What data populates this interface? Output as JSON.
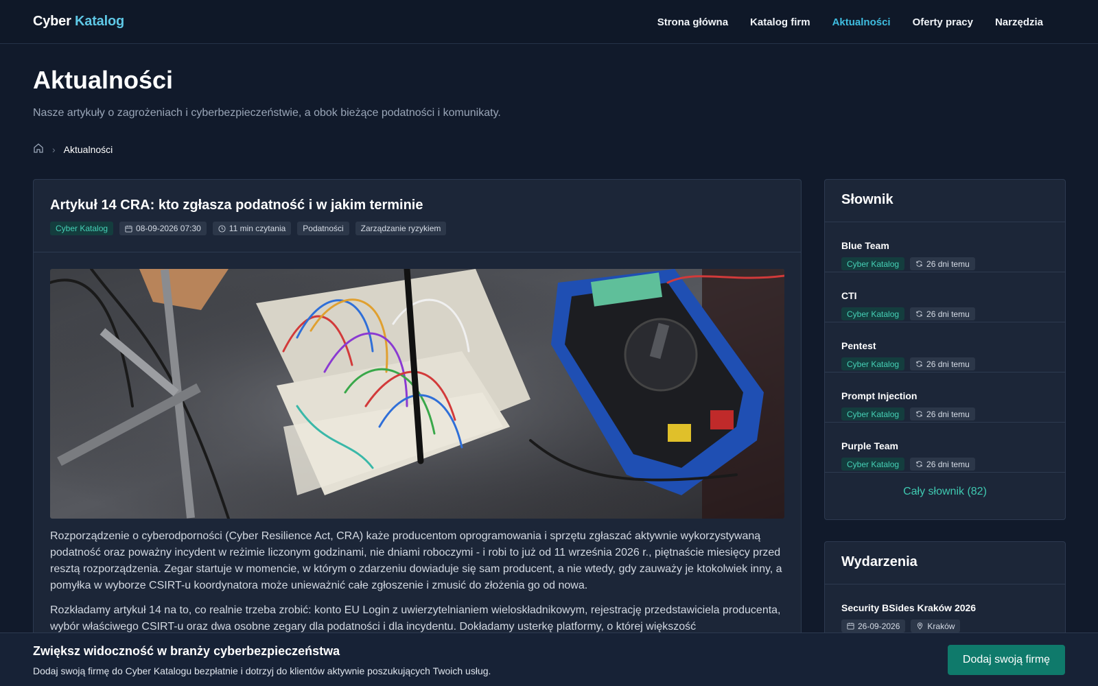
{
  "header": {
    "logo_main": "Cyber ",
    "logo_accent": "Katalog",
    "nav": [
      "Strona główna",
      "Katalog firm",
      "Aktualności",
      "Oferty pracy",
      "Narzędzia"
    ],
    "active_nav": "Aktualności"
  },
  "hero": {
    "title": "Aktualności",
    "subtitle": "Nasze artykuły o zagrożeniach i cyberbezpieczeństwie, a obok bieżące podatności i komunikaty.",
    "breadcrumb_current": "Aktualności"
  },
  "article": {
    "title": "Artykuł 14 CRA: kto zgłasza podatność i w jakim terminie",
    "source": "Cyber Katalog",
    "date": "08-09-2026 07:30",
    "read_time": "11 min czytania",
    "tags": [
      "Podatności",
      "Zarządzanie ryzykiem"
    ],
    "image_alt": "breadboard-and-multimeter-photo",
    "paragraphs": [
      "Rozporządzenie o cyberodporności (Cyber Resilience Act, CRA) każe producentom oprogramowania i sprzętu zgłaszać aktywnie wykorzystywaną podatność oraz poważny incydent w reżimie liczonym godzinami, nie dniami roboczymi - i robi to już od 11 września 2026 r., piętnaście miesięcy przed resztą rozporządzenia. Zegar startuje w momencie, w którym o zdarzeniu dowiaduje się sam producent, a nie wtedy, gdy zauważy je ktokolwiek inny, a pomyłka w wyborze CSIRT-u koordynatora może unieważnić całe zgłoszenie i zmusić do złożenia go od nowa.",
      "Rozkładamy artykuł 14 na to, co realnie trzeba zrobić: konto EU Login z uwierzytelnianiem wieloskładnikowym, rejestrację przedstawiciela producenta, wybór właściwego CSIRT-u oraz dwa osobne zegary dla podatności i dla incydentu. Dokładamy usterkę platformy, o której większość"
    ]
  },
  "glossary": {
    "title": "Słownik",
    "items": [
      {
        "title": "Blue Team",
        "source": "Cyber Katalog",
        "updated": "26 dni temu"
      },
      {
        "title": "CTI",
        "source": "Cyber Katalog",
        "updated": "26 dni temu"
      },
      {
        "title": "Pentest",
        "source": "Cyber Katalog",
        "updated": "26 dni temu"
      },
      {
        "title": "Prompt Injection",
        "source": "Cyber Katalog",
        "updated": "26 dni temu"
      },
      {
        "title": "Purple Team",
        "source": "Cyber Katalog",
        "updated": "26 dni temu"
      }
    ],
    "footer_link": "Cały słownik (82)"
  },
  "events": {
    "title": "Wydarzenia",
    "items": [
      {
        "title": "Security BSides Kraków 2026",
        "date": "26-09-2026",
        "location": "Kraków"
      }
    ]
  },
  "banner": {
    "title": "Zwiększ widoczność w branży cyberbezpieczeństwa",
    "text": "Dodaj swoją firmę do Cyber Katalogu bezpłatnie i dotrzyj do klientów aktywnie poszukujących Twoich usług.",
    "button": "Dodaj swoją firmę"
  },
  "colors": {
    "accent": "#3fbde0",
    "brand_green": "#45d1b6",
    "button": "#0f7a6b",
    "background": "#111a2b"
  }
}
